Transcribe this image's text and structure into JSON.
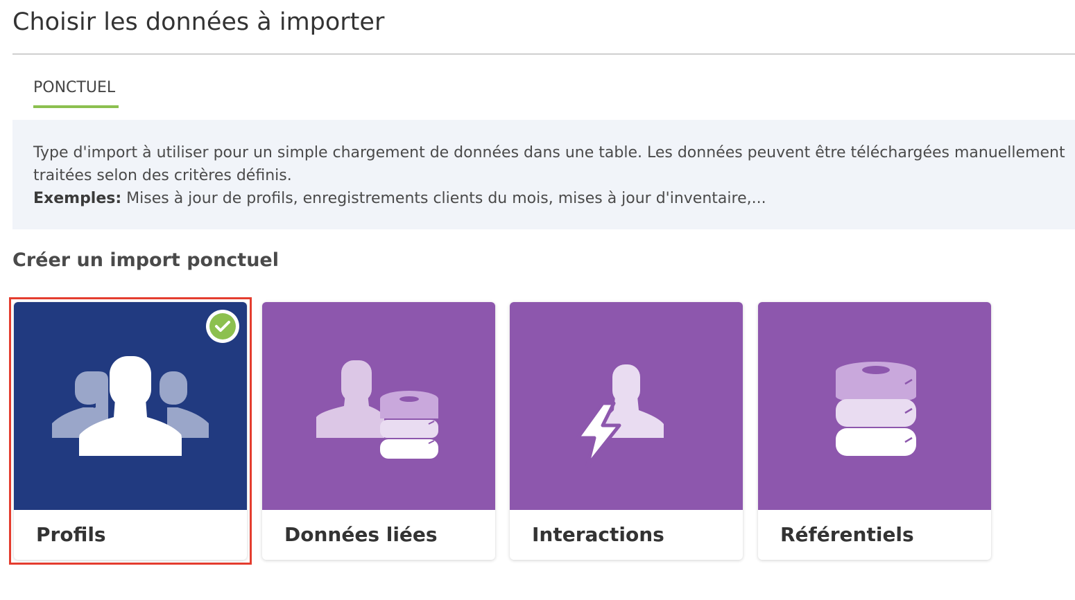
{
  "header": {
    "title": "Choisir les données à importer"
  },
  "tabs": [
    {
      "label": "PONCTUEL",
      "active": true
    }
  ],
  "info": {
    "line1": "Type d'import à utiliser pour un simple chargement de données dans une table. Les données peuvent être téléchargées manuellement",
    "line2": "traitées selon des critères définis.",
    "examples_label": "Exemples:",
    "examples_text": " Mises à jour de profils, enregistrements clients du mois, mises à jour d'inventaire,..."
  },
  "section": {
    "title": "Créer un import ponctuel"
  },
  "cards": [
    {
      "label": "Profils",
      "icon": "users-group-icon",
      "color": "#213a80",
      "selected": true
    },
    {
      "label": "Données liées",
      "icon": "user-database-icon",
      "color": "#8d57ad",
      "selected": false
    },
    {
      "label": "Interactions",
      "icon": "user-lightning-icon",
      "color": "#8d57ad",
      "selected": false
    },
    {
      "label": "Référentiels",
      "icon": "database-icon",
      "color": "#8d57ad",
      "selected": false
    }
  ],
  "colors": {
    "tab_accent": "#8cc04f",
    "selection_border": "#e43d2f",
    "check_badge": "#8cc04f",
    "info_background": "#f1f4f9"
  }
}
